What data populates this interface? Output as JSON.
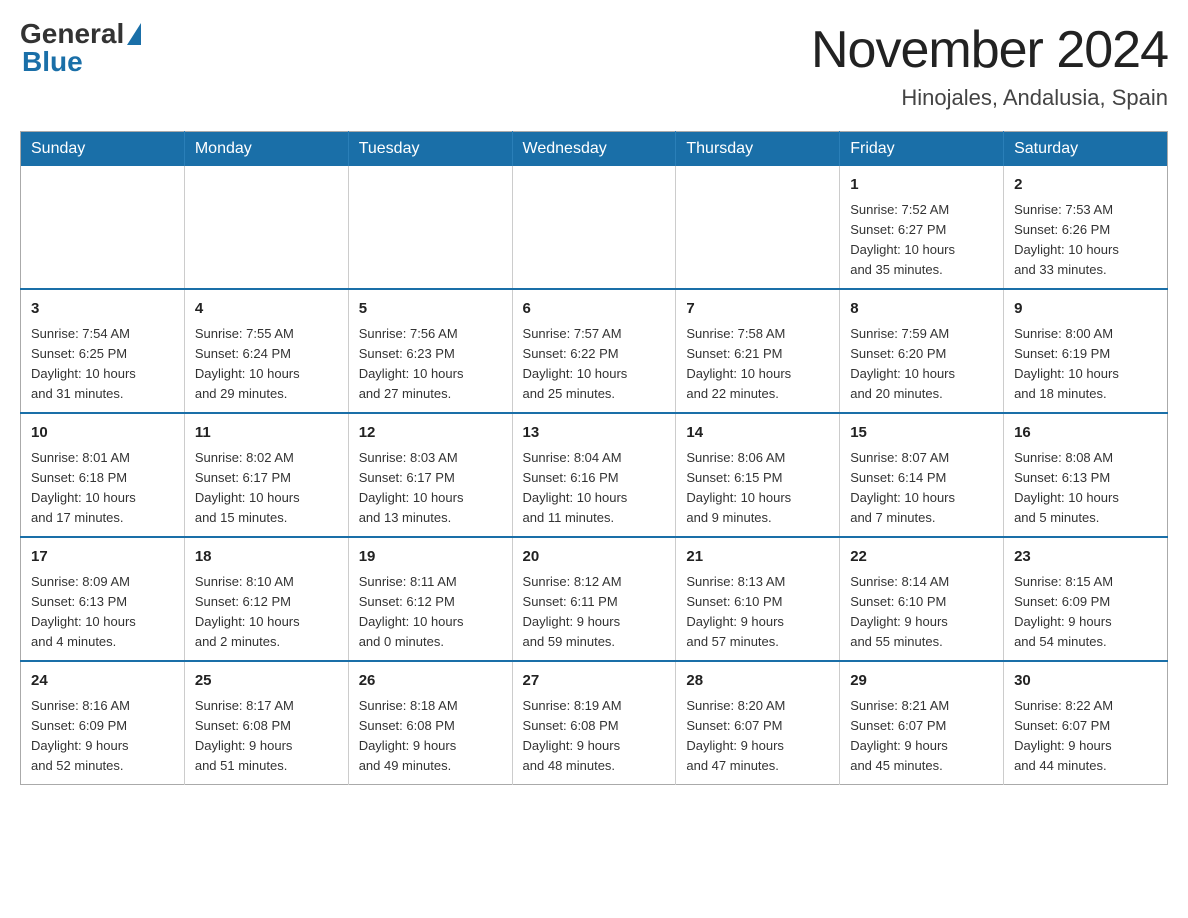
{
  "header": {
    "logo_general": "General",
    "logo_blue": "Blue",
    "title": "November 2024",
    "subtitle": "Hinojales, Andalusia, Spain"
  },
  "days_of_week": [
    "Sunday",
    "Monday",
    "Tuesday",
    "Wednesday",
    "Thursday",
    "Friday",
    "Saturday"
  ],
  "weeks": [
    {
      "days": [
        {
          "num": "",
          "info": "",
          "empty": true
        },
        {
          "num": "",
          "info": "",
          "empty": true
        },
        {
          "num": "",
          "info": "",
          "empty": true
        },
        {
          "num": "",
          "info": "",
          "empty": true
        },
        {
          "num": "",
          "info": "",
          "empty": true
        },
        {
          "num": "1",
          "info": "Sunrise: 7:52 AM\nSunset: 6:27 PM\nDaylight: 10 hours\nand 35 minutes."
        },
        {
          "num": "2",
          "info": "Sunrise: 7:53 AM\nSunset: 6:26 PM\nDaylight: 10 hours\nand 33 minutes."
        }
      ]
    },
    {
      "days": [
        {
          "num": "3",
          "info": "Sunrise: 7:54 AM\nSunset: 6:25 PM\nDaylight: 10 hours\nand 31 minutes."
        },
        {
          "num": "4",
          "info": "Sunrise: 7:55 AM\nSunset: 6:24 PM\nDaylight: 10 hours\nand 29 minutes."
        },
        {
          "num": "5",
          "info": "Sunrise: 7:56 AM\nSunset: 6:23 PM\nDaylight: 10 hours\nand 27 minutes."
        },
        {
          "num": "6",
          "info": "Sunrise: 7:57 AM\nSunset: 6:22 PM\nDaylight: 10 hours\nand 25 minutes."
        },
        {
          "num": "7",
          "info": "Sunrise: 7:58 AM\nSunset: 6:21 PM\nDaylight: 10 hours\nand 22 minutes."
        },
        {
          "num": "8",
          "info": "Sunrise: 7:59 AM\nSunset: 6:20 PM\nDaylight: 10 hours\nand 20 minutes."
        },
        {
          "num": "9",
          "info": "Sunrise: 8:00 AM\nSunset: 6:19 PM\nDaylight: 10 hours\nand 18 minutes."
        }
      ]
    },
    {
      "days": [
        {
          "num": "10",
          "info": "Sunrise: 8:01 AM\nSunset: 6:18 PM\nDaylight: 10 hours\nand 17 minutes."
        },
        {
          "num": "11",
          "info": "Sunrise: 8:02 AM\nSunset: 6:17 PM\nDaylight: 10 hours\nand 15 minutes."
        },
        {
          "num": "12",
          "info": "Sunrise: 8:03 AM\nSunset: 6:17 PM\nDaylight: 10 hours\nand 13 minutes."
        },
        {
          "num": "13",
          "info": "Sunrise: 8:04 AM\nSunset: 6:16 PM\nDaylight: 10 hours\nand 11 minutes."
        },
        {
          "num": "14",
          "info": "Sunrise: 8:06 AM\nSunset: 6:15 PM\nDaylight: 10 hours\nand 9 minutes."
        },
        {
          "num": "15",
          "info": "Sunrise: 8:07 AM\nSunset: 6:14 PM\nDaylight: 10 hours\nand 7 minutes."
        },
        {
          "num": "16",
          "info": "Sunrise: 8:08 AM\nSunset: 6:13 PM\nDaylight: 10 hours\nand 5 minutes."
        }
      ]
    },
    {
      "days": [
        {
          "num": "17",
          "info": "Sunrise: 8:09 AM\nSunset: 6:13 PM\nDaylight: 10 hours\nand 4 minutes."
        },
        {
          "num": "18",
          "info": "Sunrise: 8:10 AM\nSunset: 6:12 PM\nDaylight: 10 hours\nand 2 minutes."
        },
        {
          "num": "19",
          "info": "Sunrise: 8:11 AM\nSunset: 6:12 PM\nDaylight: 10 hours\nand 0 minutes."
        },
        {
          "num": "20",
          "info": "Sunrise: 8:12 AM\nSunset: 6:11 PM\nDaylight: 9 hours\nand 59 minutes."
        },
        {
          "num": "21",
          "info": "Sunrise: 8:13 AM\nSunset: 6:10 PM\nDaylight: 9 hours\nand 57 minutes."
        },
        {
          "num": "22",
          "info": "Sunrise: 8:14 AM\nSunset: 6:10 PM\nDaylight: 9 hours\nand 55 minutes."
        },
        {
          "num": "23",
          "info": "Sunrise: 8:15 AM\nSunset: 6:09 PM\nDaylight: 9 hours\nand 54 minutes."
        }
      ]
    },
    {
      "days": [
        {
          "num": "24",
          "info": "Sunrise: 8:16 AM\nSunset: 6:09 PM\nDaylight: 9 hours\nand 52 minutes."
        },
        {
          "num": "25",
          "info": "Sunrise: 8:17 AM\nSunset: 6:08 PM\nDaylight: 9 hours\nand 51 minutes."
        },
        {
          "num": "26",
          "info": "Sunrise: 8:18 AM\nSunset: 6:08 PM\nDaylight: 9 hours\nand 49 minutes."
        },
        {
          "num": "27",
          "info": "Sunrise: 8:19 AM\nSunset: 6:08 PM\nDaylight: 9 hours\nand 48 minutes."
        },
        {
          "num": "28",
          "info": "Sunrise: 8:20 AM\nSunset: 6:07 PM\nDaylight: 9 hours\nand 47 minutes."
        },
        {
          "num": "29",
          "info": "Sunrise: 8:21 AM\nSunset: 6:07 PM\nDaylight: 9 hours\nand 45 minutes."
        },
        {
          "num": "30",
          "info": "Sunrise: 8:22 AM\nSunset: 6:07 PM\nDaylight: 9 hours\nand 44 minutes."
        }
      ]
    }
  ]
}
